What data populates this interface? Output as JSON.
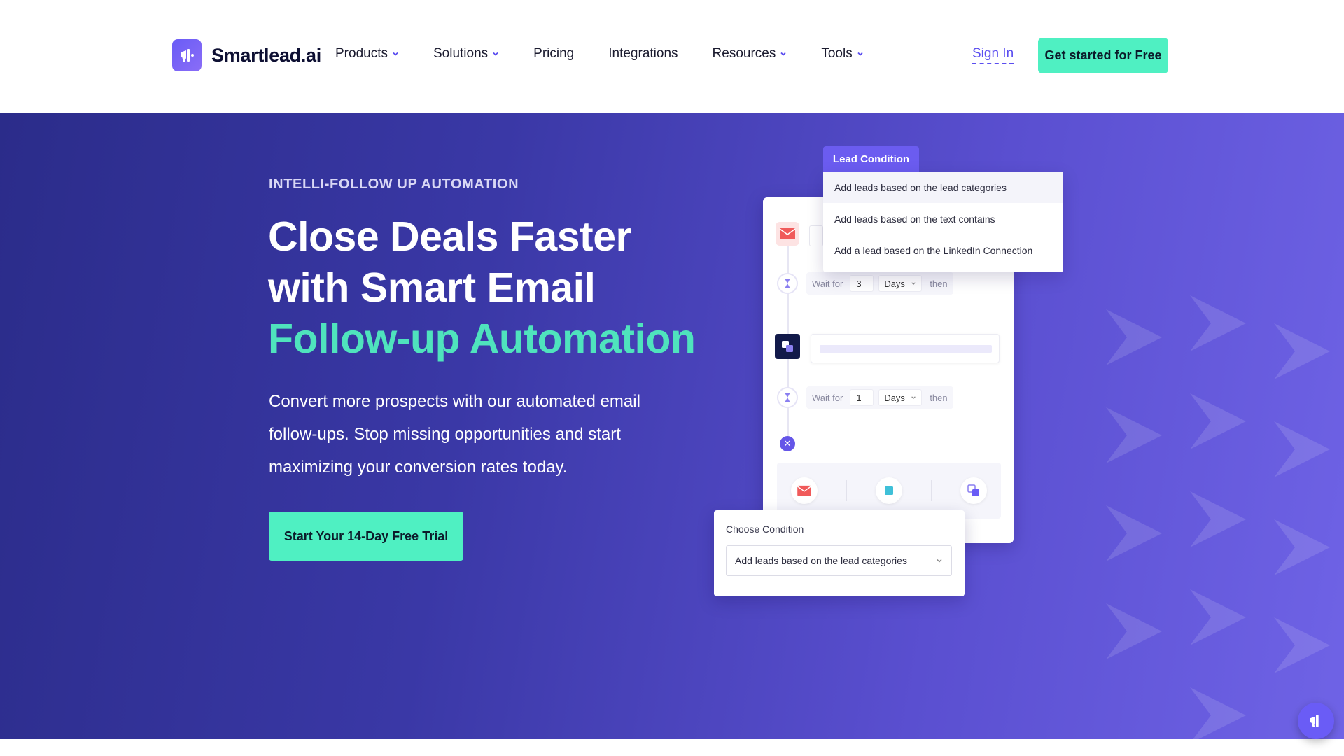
{
  "brand": {
    "name": "Smartlead.ai",
    "accent": "#6a5cf6",
    "cta_color": "#4ff0c2"
  },
  "nav": {
    "items": [
      {
        "label": "Products",
        "has_dropdown": true
      },
      {
        "label": "Solutions",
        "has_dropdown": true
      },
      {
        "label": "Pricing",
        "has_dropdown": false
      },
      {
        "label": "Integrations",
        "has_dropdown": false
      },
      {
        "label": "Resources",
        "has_dropdown": true
      },
      {
        "label": "Tools",
        "has_dropdown": true
      }
    ],
    "signin": "Sign In",
    "cta": "Get started for Free"
  },
  "hero": {
    "eyebrow": "INTELLI-FOLLOW UP AUTOMATION",
    "headline_line1": "Close Deals Faster",
    "headline_line2": "with Smart Email",
    "headline_accent": "Follow-up Automation",
    "subtext": "Convert more prospects with our automated email follow-ups. Stop missing opportunities and start maximizing your conversion rates today.",
    "cta": "Start Your 14-Day Free Trial"
  },
  "illustration": {
    "lead_condition": {
      "tab": "Lead Condition",
      "options": [
        "Add leads based on the lead categories",
        "Add leads based on the text contains",
        "Add a lead based on the LinkedIn Connection"
      ]
    },
    "wait1": {
      "prefix": "Wait for",
      "value": "3",
      "unit": "Days",
      "suffix": "then"
    },
    "wait2": {
      "prefix": "Wait for",
      "value": "1",
      "unit": "Days",
      "suffix": "then"
    },
    "choose": {
      "label": "Choose Condition",
      "selected": "Add leads based on the lead categories"
    }
  }
}
